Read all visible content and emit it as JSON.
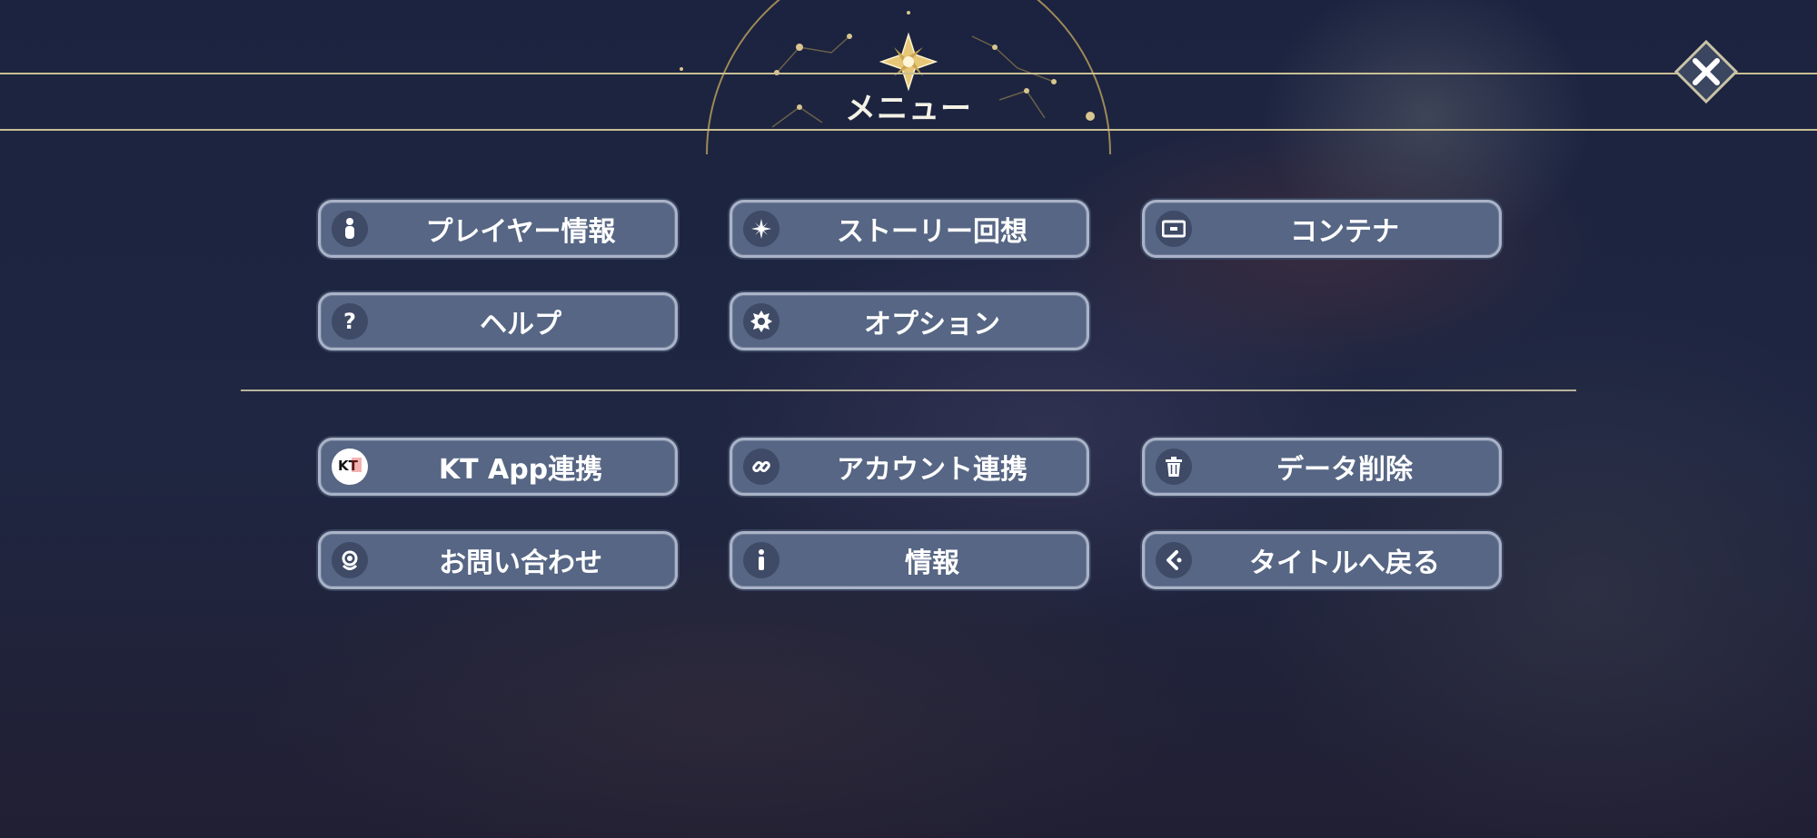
{
  "header": {
    "title": "メニュー"
  },
  "close": {
    "icon": "close-icon"
  },
  "menu_top": [
    {
      "label": "プレイヤー情報",
      "icon": "player-icon"
    },
    {
      "label": "ストーリー回想",
      "icon": "sparkle-icon"
    },
    {
      "label": "コンテナ",
      "icon": "container-icon"
    },
    {
      "label": "ヘルプ",
      "icon": "help-icon"
    },
    {
      "label": "オプション",
      "icon": "gear-icon"
    }
  ],
  "menu_bottom": [
    {
      "label": "KT App連携",
      "icon": "kt-app-icon",
      "icon_text": "KT"
    },
    {
      "label": "アカウント連携",
      "icon": "link-icon"
    },
    {
      "label": "データ削除",
      "icon": "trash-icon"
    },
    {
      "label": "お問い合わせ",
      "icon": "support-icon"
    },
    {
      "label": "情報",
      "icon": "info-icon"
    },
    {
      "label": "タイトルへ戻る",
      "icon": "back-icon"
    }
  ],
  "colors": {
    "button_bg": "#566684",
    "button_border": "#aab3c7",
    "gold": "#c9bf94"
  }
}
